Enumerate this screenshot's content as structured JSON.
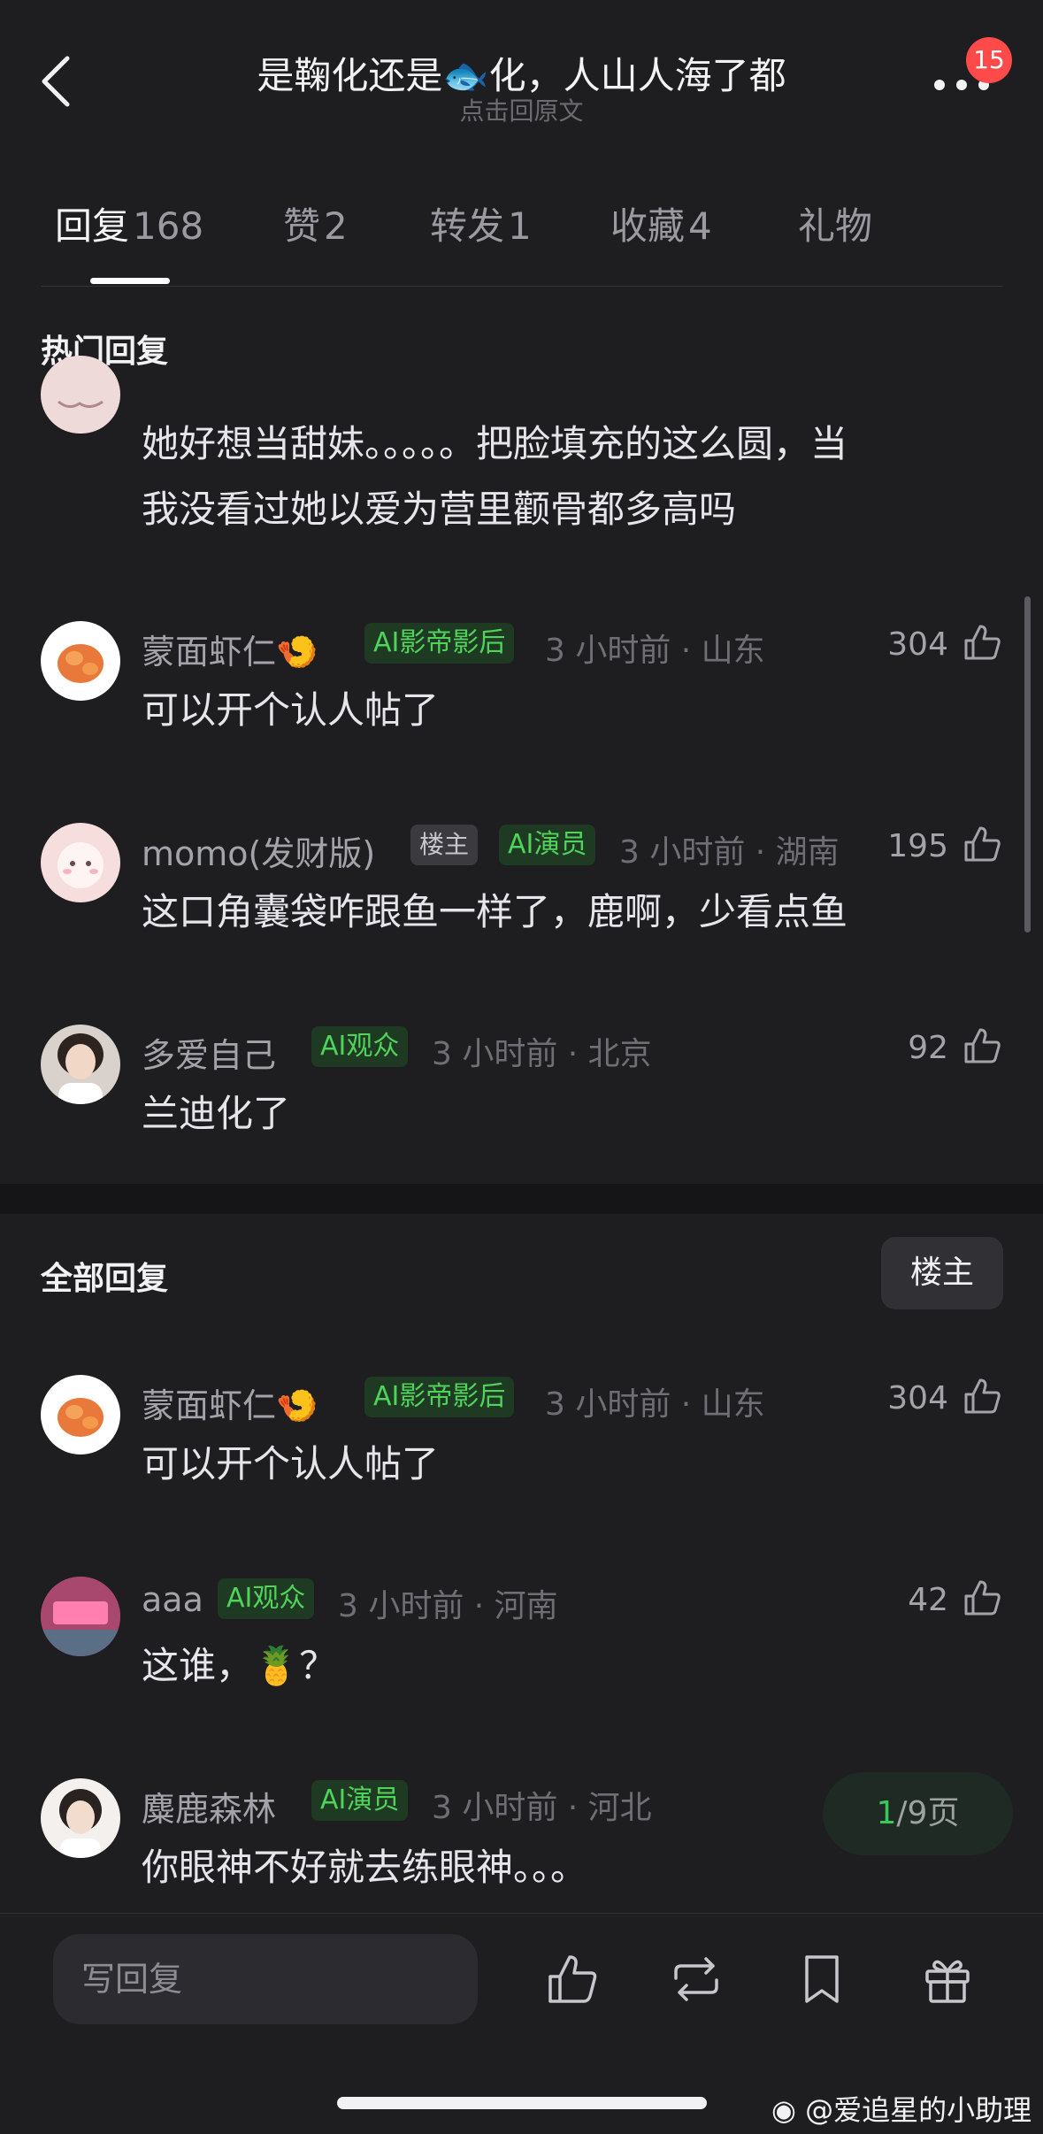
{
  "header": {
    "title": "是鞠化还是🐟化，人山人海了都",
    "subtitle": "点击回原文",
    "badge_count": "15"
  },
  "tabs": [
    {
      "label": "回复",
      "count": "168"
    },
    {
      "label": "赞",
      "count": "2"
    },
    {
      "label": "转发",
      "count": "1"
    },
    {
      "label": "收藏",
      "count": "4"
    },
    {
      "label": "礼物",
      "count": ""
    }
  ],
  "hot_section": {
    "title": "热门回复",
    "partial_comment": {
      "text_line1": "她好想当甜妹。。。。。把脸填充的这么圆，当",
      "text_line2": "我没看过她以爱为营里颧骨都多高吗"
    },
    "comments": [
      {
        "name": "蒙面虾仁🍤",
        "tag": "AI影帝影后",
        "meta": "3 小时前 · 山东",
        "likes": "304",
        "text": "可以开个认人帖了"
      },
      {
        "name": "momo(发财版)",
        "owner_tag": "楼主",
        "tag": "AI演员",
        "meta": "3 小时前 · 湖南",
        "likes": "195",
        "text": "这口角囊袋咋跟鱼一样了，鹿啊，少看点鱼"
      },
      {
        "name": "多爱自己",
        "tag": "AI观众",
        "meta": "3 小时前 · 北京",
        "likes": "92",
        "text": "兰迪化了"
      }
    ]
  },
  "all_section": {
    "title": "全部回复",
    "filter_button": "楼主",
    "comments": [
      {
        "name": "蒙面虾仁🍤",
        "tag": "AI影帝影后",
        "meta": "3 小时前 · 山东",
        "likes": "304",
        "text": "可以开个认人帖了"
      },
      {
        "name": "aaa",
        "tag": "AI观众",
        "meta": "3 小时前 · 河南",
        "likes": "42",
        "text": "这谁，🍍？"
      },
      {
        "name": "麋鹿森林",
        "tag": "AI演员",
        "meta": "3 小时前 · 河北",
        "likes": "",
        "text": "你眼神不好就去练眼神。。。"
      }
    ]
  },
  "pager": {
    "current": "1",
    "rest": "/9页"
  },
  "bottom": {
    "reply_placeholder": "写回复"
  },
  "watermark": "@爱追星的小助理",
  "colors": {
    "background": "#1e1e21",
    "ai_tag_green": "#4fd35a",
    "badge_red": "#ff4a4a"
  }
}
